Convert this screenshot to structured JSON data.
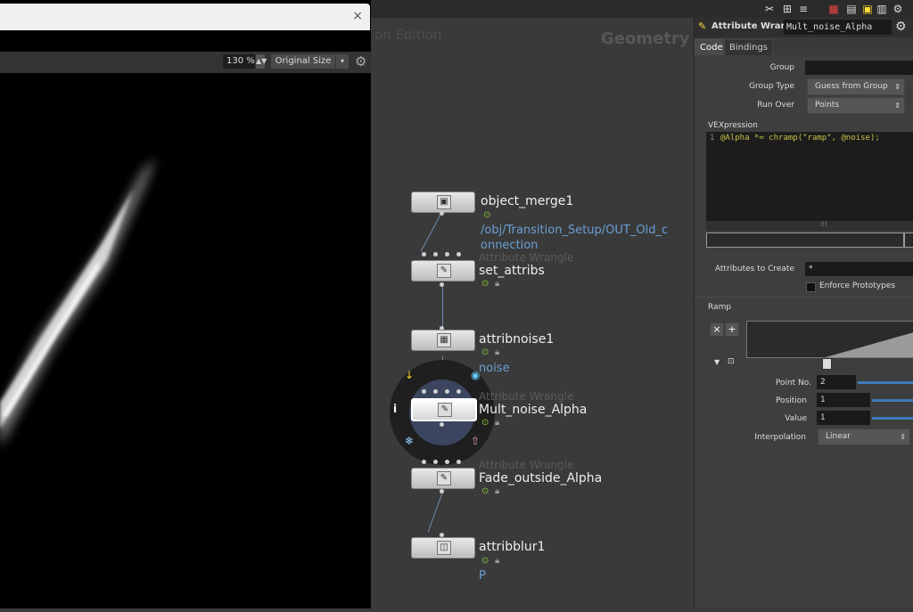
{
  "viewer": {
    "close": "×",
    "zoom": "130 %",
    "zoom_spin": "▲▼",
    "original_size": "Original Size",
    "dropdown": "▾"
  },
  "network": {
    "faded_title": "on Edition",
    "context": "Geometry",
    "nodes": [
      {
        "name": "object_merge1",
        "path": "/obj/Transition_Setup/OUT_Old_c",
        "path2": "onnection"
      },
      {
        "type": "Attribute Wrangle",
        "name": "set_attribs"
      },
      {
        "name": "attribnoise1",
        "attr": "noise"
      },
      {
        "type": "Attribute Wrangle",
        "name": "Mult_noise_Alpha"
      },
      {
        "type": "Attribute Wrangle",
        "name": "Fade_outside_Alpha"
      },
      {
        "name": "attribblur1",
        "attr": "P"
      }
    ],
    "radial": {
      "info": "i"
    }
  },
  "params": {
    "title": "Attribute Wrangle",
    "node_name": "Mult_noise_Alpha",
    "tabs": [
      "Code",
      "Bindings"
    ],
    "group_label": "Group",
    "group_value": "",
    "group_type_label": "Group Type",
    "group_type_value": "Guess from Group",
    "run_over_label": "Run Over",
    "run_over_value": "Points",
    "vex_label": "VEXpression",
    "vex_line": "1",
    "vex_code": "@Alpha *= chramp(\"ramp\", @noise);",
    "attributes_label": "Attributes to Create",
    "attributes_value": "*",
    "enforce_label": "Enforce Prototypes",
    "ramp_label": "Ramp",
    "ramp_delete": "×",
    "ramp_add": "+",
    "point_no_label": "Point No.",
    "point_no_value": "2",
    "position_label": "Position",
    "position_value": "1",
    "value_label": "Value",
    "value_value": "1",
    "interp_label": "Interpolation",
    "interp_value": "Linear"
  },
  "colors": {
    "accent": "#3f7ab8",
    "node_path": "#6a9fd4",
    "bg": "#3a3a3a"
  }
}
